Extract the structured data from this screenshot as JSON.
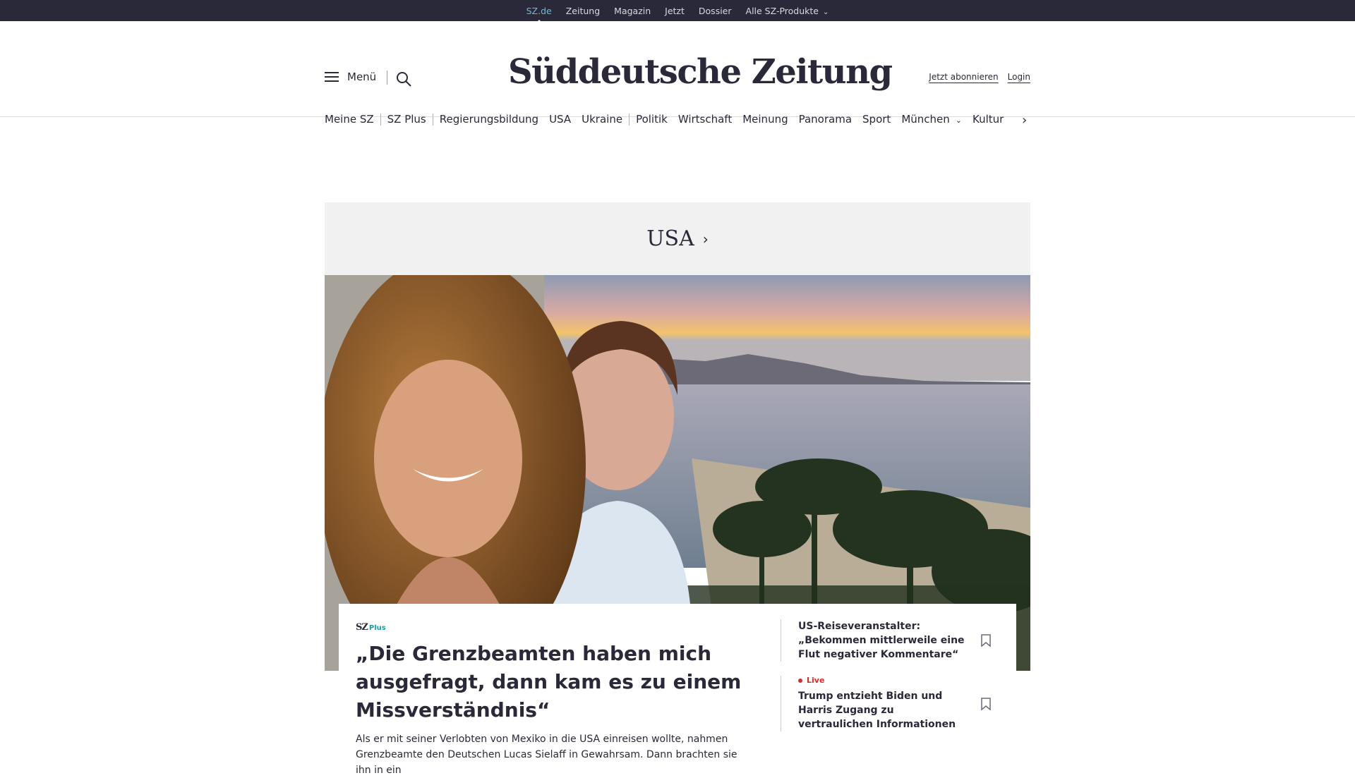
{
  "topbar": {
    "items": [
      "SZ.de",
      "Zeitung",
      "Magazin",
      "Jetzt",
      "Dossier",
      "Alle SZ-Produkte"
    ],
    "active_color": "#71b8d4"
  },
  "header": {
    "menu_label": "Menü",
    "logo_text": "Süddeutsche Zeitung",
    "subscribe_label": "Jetzt abonnieren",
    "login_label": "Login"
  },
  "nav": {
    "items": [
      "Meine SZ",
      "SZ Plus",
      "Regierungsbildung",
      "USA",
      "Ukraine",
      "Politik",
      "Wirtschaft",
      "Meinung",
      "Panorama",
      "Sport",
      "München",
      "Kultur"
    ]
  },
  "section": {
    "title": "USA"
  },
  "teaser": {
    "badge_sz": "SZ",
    "badge_plus": "Plus",
    "headline": "„Die Grenzbeamten haben mich ausgefragt, dann kam es zu einem Missverständnis“",
    "lead": "Als er mit seiner Verlobten von Mexiko in die USA einreisen wollte, nahmen Grenzbeamte den Deutschen Lucas Sielaff in Gewahrsam. Dann brachten sie ihn in ein"
  },
  "sidebar": {
    "items": [
      {
        "title": "US-Reiseveranstalter: „Bekommen mittlerweile eine Flut negativer Kommentare“"
      },
      {
        "live_label": "Live",
        "title": "Trump entzieht Biden und Harris Zugang zu vertraulichen Informationen"
      }
    ]
  },
  "colors": {
    "brand_dark": "#29293a",
    "sz_plus": "#1c9ba5",
    "live_red": "#d22d2d"
  }
}
